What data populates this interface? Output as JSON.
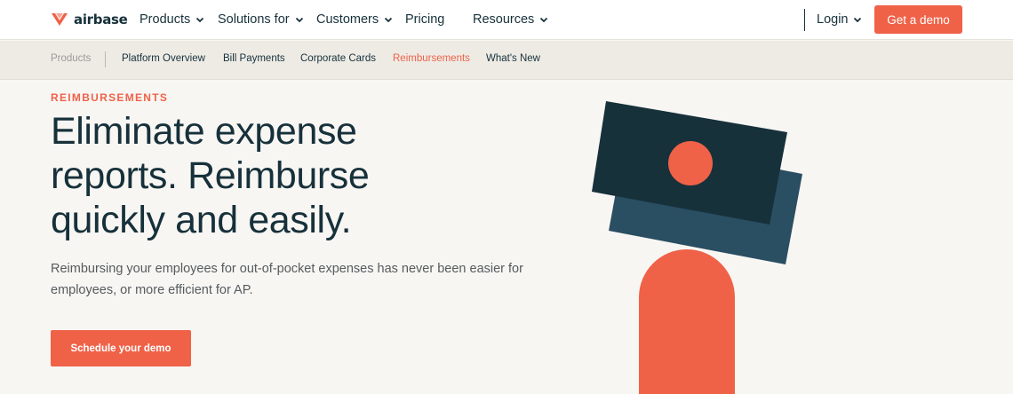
{
  "brand": {
    "name": "airbase",
    "logo_color": "#ef6248"
  },
  "nav": {
    "items": [
      {
        "label": "Products",
        "has_dropdown": true
      },
      {
        "label": "Solutions for",
        "has_dropdown": true
      },
      {
        "label": "Customers",
        "has_dropdown": true
      },
      {
        "label": "Pricing",
        "has_dropdown": false
      },
      {
        "label": "Resources",
        "has_dropdown": true
      }
    ],
    "login_label": "Login",
    "demo_label": "Get a demo"
  },
  "subnav": {
    "section_label": "Products",
    "items": [
      {
        "label": "Platform Overview",
        "active": false
      },
      {
        "label": "Bill Payments",
        "active": false
      },
      {
        "label": "Corporate Cards",
        "active": false
      },
      {
        "label": "Reimbursements",
        "active": true
      },
      {
        "label": "What's New",
        "active": false
      }
    ]
  },
  "hero": {
    "eyebrow": "REIMBURSEMENTS",
    "headline_lines": [
      "Eliminate expense",
      "reports. Reimburse",
      "quickly and easily."
    ],
    "subtext": "Reimbursing your employees for out-of-pocket expenses has never been easier for employees, or more efficient for AP.",
    "cta_label": "Schedule your demo"
  },
  "colors": {
    "accent": "#ef6248",
    "dark_navy": "#17313b",
    "slate_blue": "#2a4e62",
    "background": "#f8f6f3",
    "subnav_bg": "#eeebe5"
  }
}
